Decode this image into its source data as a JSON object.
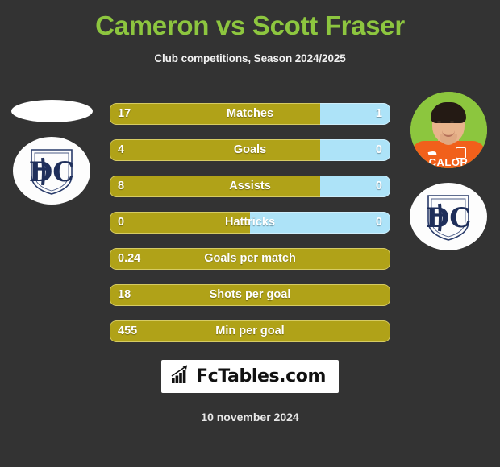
{
  "header": {
    "title": "Cameron vs Scott Fraser",
    "subtitle": "Club competitions, Season 2024/2025",
    "title_color": "#8DC63F"
  },
  "colors": {
    "background": "#333333",
    "left_player_bar": "#B0A218",
    "right_player_bar": "#ADE3F8",
    "title_green": "#8DC63F",
    "crest_navy": "#1F2F5B"
  },
  "left_player": {
    "avatar": "blank-ellipse-photo",
    "crest": "dundee-fc-crest",
    "crest_monogram": "DFC"
  },
  "right_player": {
    "avatar": "player-photo-orange-jersey",
    "jersey_sponsor": "CALOR",
    "crest": "dundee-fc-crest",
    "crest_monogram": "DFC"
  },
  "footer": {
    "logo_text": "FcTables.com",
    "logo_icon": "bar-chart-icon",
    "date": "10 november 2024"
  },
  "chart_data": {
    "type": "bar",
    "title": "Cameron vs Scott Fraser",
    "subtitle": "Club competitions, Season 2024/2025",
    "orientation": "horizontal-diverging",
    "legend": [
      "Cameron",
      "Scott Fraser"
    ],
    "series": [
      {
        "name": "Cameron",
        "color": "#B0A218",
        "values": [
          17,
          4,
          8,
          0,
          0.24,
          18,
          455
        ]
      },
      {
        "name": "Scott Fraser",
        "color": "#ADE3F8",
        "values": [
          1,
          0,
          0,
          0,
          null,
          null,
          null
        ]
      }
    ],
    "categories": [
      "Matches",
      "Goals",
      "Assists",
      "Hattricks",
      "Goals per match",
      "Shots per goal",
      "Min per goal"
    ],
    "rows": [
      {
        "label": "Matches",
        "left": "17",
        "right": "1",
        "left_pct": 75,
        "has_right": true
      },
      {
        "label": "Goals",
        "left": "4",
        "right": "0",
        "left_pct": 75,
        "has_right": true
      },
      {
        "label": "Assists",
        "left": "8",
        "right": "0",
        "left_pct": 75,
        "has_right": true
      },
      {
        "label": "Hattricks",
        "left": "0",
        "right": "0",
        "left_pct": 50,
        "has_right": true
      },
      {
        "label": "Goals per match",
        "left": "0.24",
        "right": "",
        "left_pct": 100,
        "has_right": false
      },
      {
        "label": "Shots per goal",
        "left": "18",
        "right": "",
        "left_pct": 100,
        "has_right": false
      },
      {
        "label": "Min per goal",
        "left": "455",
        "right": "",
        "left_pct": 100,
        "has_right": false
      }
    ]
  }
}
